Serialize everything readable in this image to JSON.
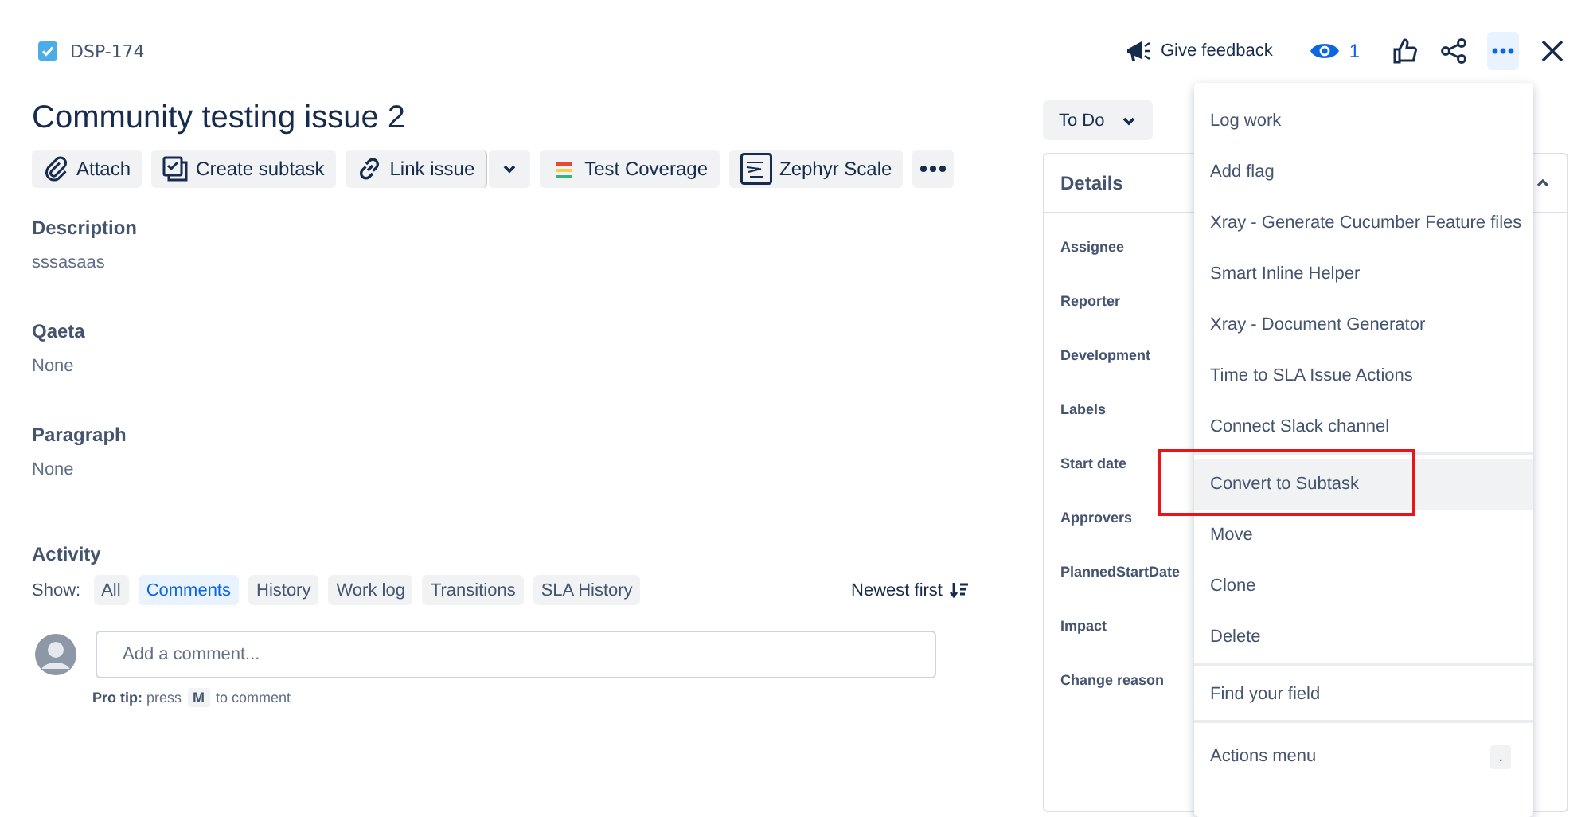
{
  "issue_key": "DSP-174",
  "header_actions": {
    "feedback": "Give feedback",
    "watchers": "1"
  },
  "title": "Community testing issue 2",
  "toolbar": [
    {
      "label": "Attach",
      "kind": "attach"
    },
    {
      "label": "Create subtask",
      "kind": "subtask"
    },
    {
      "label": "Link issue",
      "kind": "link"
    },
    {
      "label": "Test Coverage",
      "kind": "coverage"
    },
    {
      "label": "Zephyr Scale",
      "kind": "zephyr"
    }
  ],
  "fields": [
    {
      "label": "Description",
      "value": "sssasaas"
    },
    {
      "label": "Qaeta",
      "value": "None"
    },
    {
      "label": "Paragraph",
      "value": "None"
    }
  ],
  "activity": {
    "title": "Activity",
    "show_label": "Show:",
    "filters": [
      {
        "label": "All",
        "selected": false
      },
      {
        "label": "Comments",
        "selected": true
      },
      {
        "label": "History",
        "selected": false
      },
      {
        "label": "Work log",
        "selected": false
      },
      {
        "label": "Transitions",
        "selected": false
      },
      {
        "label": "SLA History",
        "selected": false
      }
    ],
    "sort": "Newest first",
    "comment_placeholder": "Add a comment...",
    "tip": "**Pro tip:** press",
    "tip_key": "M",
    "tip_end": "to comment"
  },
  "status": "To Do",
  "details": {
    "title": "Details",
    "fields": [
      "Assignee",
      "Reporter",
      "Development",
      "Labels",
      "Start date",
      "Approvers",
      "PlannedStartDate",
      "Impact",
      "Change reason"
    ]
  },
  "menu": {
    "sections": [
      [
        {
          "label": "Log work",
          "highlighted": false
        },
        {
          "label": "Add flag",
          "highlighted": false
        },
        {
          "label": "Xray - Generate Cucumber Feature files",
          "highlighted": false
        },
        {
          "label": "Smart Inline Helper",
          "highlighted": false
        },
        {
          "label": "Xray - Document Generator",
          "highlighted": false
        },
        {
          "label": "Time to SLA Issue Actions",
          "highlighted": false
        },
        {
          "label": "Connect Slack channel",
          "highlighted": false
        }
      ],
      [
        {
          "label": "Convert to Subtask",
          "highlighted": true
        },
        {
          "label": "Move",
          "highlighted": false
        },
        {
          "label": "Clone",
          "highlighted": false
        },
        {
          "label": "Delete",
          "highlighted": false
        }
      ],
      [
        {
          "label": "Find your field",
          "highlighted": false
        }
      ],
      [
        {
          "label": "Actions menu",
          "highlighted": false,
          "shortcut": "."
        }
      ]
    ]
  }
}
